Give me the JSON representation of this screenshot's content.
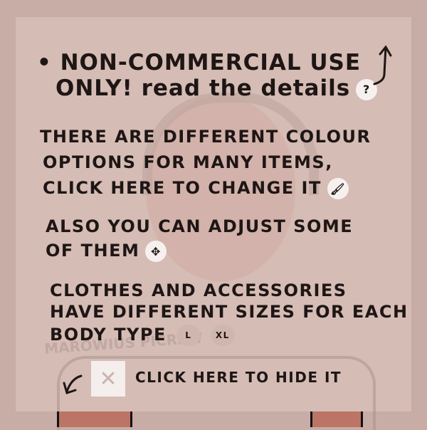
{
  "notice": {
    "line1": "NON-COMMERCIAL USE",
    "line2": "ONLY! read the details",
    "help_icon": "?"
  },
  "colour": {
    "line1": "THERE ARE DIFFERENT  COLOUR",
    "line2": "OPTIONS FOR MANY ITEMS,",
    "line3": "CLICK HERE TO CHANGE IT"
  },
  "adjust": {
    "line1": "ALSO YOU CAN ADJUST SOME",
    "line2": "OF THEM"
  },
  "sizes": {
    "line1": "CLOTHES AND ACCESSORIES",
    "line2": "HAVE DIFFERENT SIZES FOR EACH",
    "line3": "BODY TYPE",
    "options": [
      "L",
      "XL"
    ]
  },
  "hide": {
    "label": "CLICK HERE TO HIDE IT",
    "close_icon": "✕"
  },
  "watermark": "MAROWIUS PICREW",
  "colors": {
    "panel": "#d5bcb5",
    "background": "#c8aca6",
    "text": "#1e1615"
  }
}
